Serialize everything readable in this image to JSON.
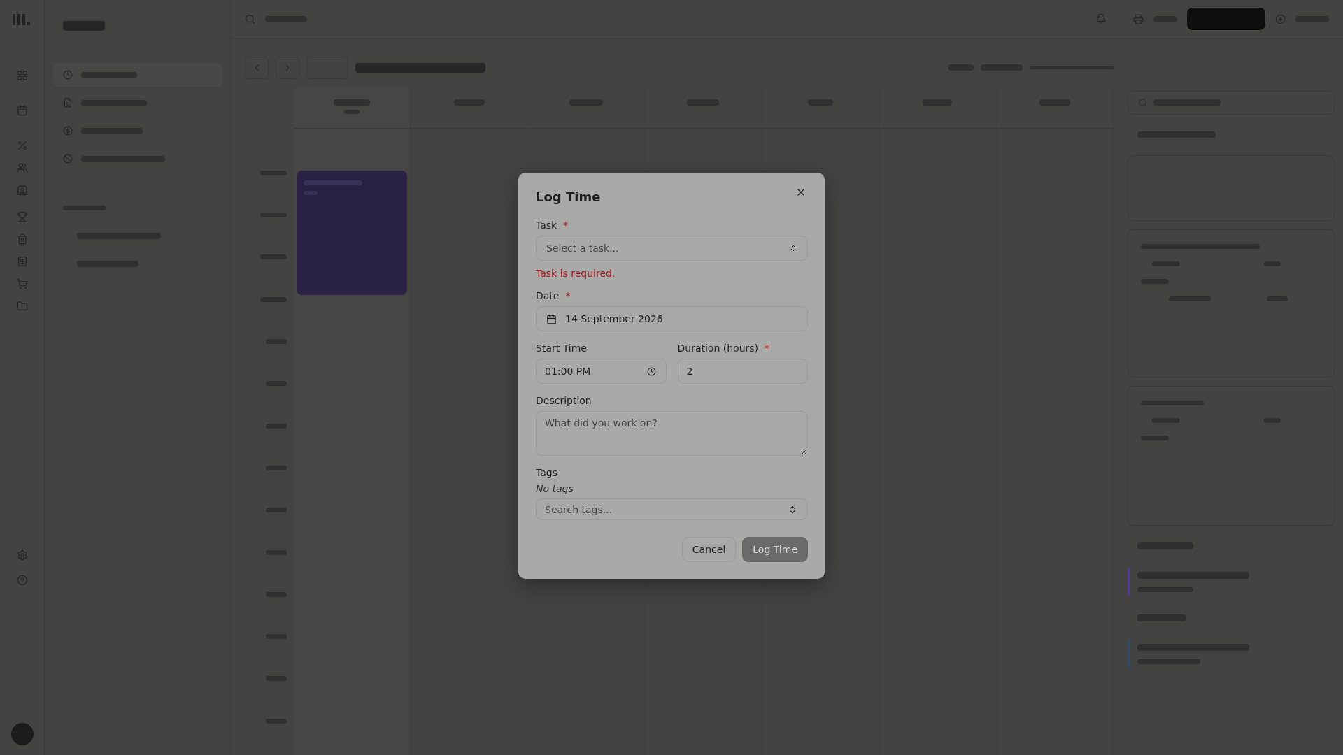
{
  "dialog": {
    "title": "Log Time",
    "required_mark": "*",
    "rows": [
      [
        {
          "kind": "select",
          "label": "Task",
          "required": true,
          "placeholder": "Select a task...",
          "error": "Task is required."
        }
      ],
      [
        {
          "kind": "date",
          "label": "Date",
          "required": true,
          "value": "14 September 2026"
        }
      ],
      [
        {
          "kind": "time",
          "label": "Start Time",
          "required": false,
          "value": "01:00 PM"
        },
        {
          "kind": "number",
          "label": "Duration (hours)",
          "required": true,
          "value": "2"
        }
      ],
      [
        {
          "kind": "textarea",
          "label": "Description",
          "required": false,
          "placeholder": "What did you work on?"
        }
      ],
      [
        {
          "kind": "tags",
          "label": "Tags",
          "required": false,
          "empty_text": "No tags",
          "placeholder": "Search tags..."
        }
      ]
    ],
    "buttons": [
      {
        "kind": "secondary",
        "label": "Cancel",
        "disabled": false
      },
      {
        "kind": "primary",
        "label": "Log Time",
        "disabled": true
      }
    ]
  }
}
